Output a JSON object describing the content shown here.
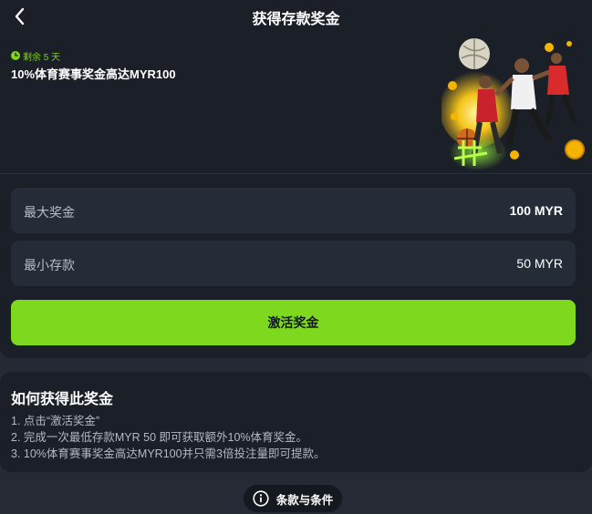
{
  "header": {
    "title": "获得存款奖金",
    "back_icon": "chevron-left-icon"
  },
  "promo": {
    "timer_text": "剩余 5 天",
    "timer_icon": "clock-icon",
    "title": "10%体育赛事奖金高达MYR100",
    "accent_color": "#7ed321"
  },
  "details": {
    "max_bonus": {
      "label": "最大奖金",
      "value": "100 MYR"
    },
    "min_deposit": {
      "label": "最小存款",
      "value": "50 MYR"
    }
  },
  "actions": {
    "activate_label": "激活奖金",
    "button_color": "#7ed91e"
  },
  "how_to": {
    "title": "如何获得此奖金",
    "steps": [
      "1. 点击“激活奖金”",
      "2. 完成一次最低存款MYR 50 即可获取额外10%体育奖金。",
      "3. 10%体育赛事奖金高达MYR100并只需3倍投注量即可提款。"
    ]
  },
  "footer": {
    "terms_label": "条款与条件",
    "terms_icon": "info-icon"
  }
}
